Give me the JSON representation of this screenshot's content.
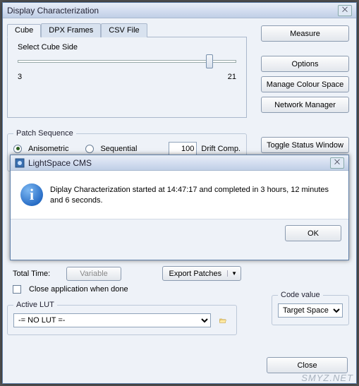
{
  "window": {
    "title": "Display Characterization",
    "close_glyph": "⨉"
  },
  "tabs": {
    "items": [
      "Cube",
      "DPX Frames",
      "CSV File"
    ],
    "active": 0
  },
  "cube": {
    "label": "Select Cube Side",
    "min": "3",
    "max": "21",
    "thumb_pct": 86
  },
  "sidebar": {
    "measure": "Measure",
    "options": "Options",
    "manage_colour": "Manage Colour Space",
    "network_manager": "Network Manager",
    "toggle_status": "Toggle Status Window",
    "close": "Close"
  },
  "patch": {
    "legend": "Patch Sequence",
    "anisometric": "Anisometric",
    "sequential": "Sequential",
    "drift_value": "100",
    "drift_label": "Drift Comp."
  },
  "time": {
    "total_label": "Total Time:",
    "total_value": "Variable",
    "export": "Export Patches",
    "close_app": "Close application when done"
  },
  "code": {
    "legend": "Code value",
    "value": "Target Space"
  },
  "lut": {
    "legend": "Active LUT",
    "value": "-= NO LUT =-"
  },
  "modal": {
    "title": "LightSpace CMS",
    "close_glyph": "⨉",
    "info_glyph": "i",
    "message": "Diplay Characterization started at 14:47:17 and completed in 3 hours, 12 minutes and 6 seconds.",
    "ok": "OK"
  },
  "watermark": "SMYZ.NET"
}
